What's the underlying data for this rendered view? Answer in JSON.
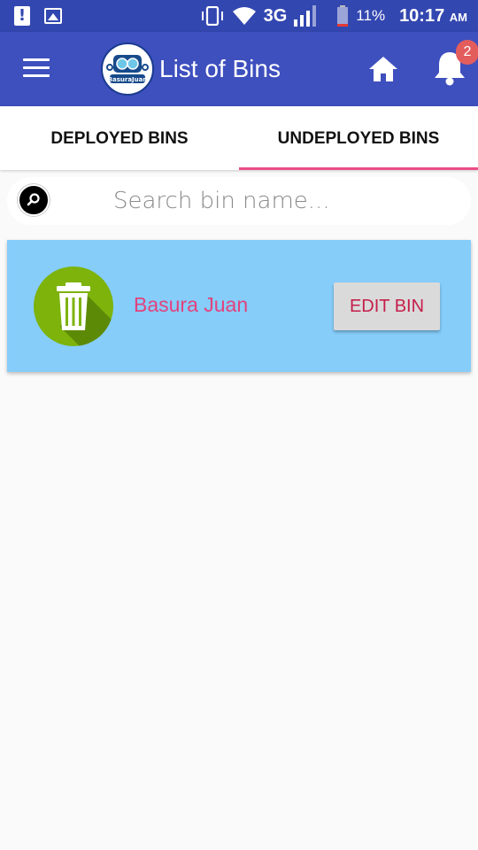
{
  "status_bar": {
    "network": "3G",
    "battery": "11%",
    "time": "10:17",
    "ampm": "AM"
  },
  "app_bar": {
    "title": "List of Bins",
    "logo_text": "BasuraJuan",
    "notification_count": "2"
  },
  "tabs": [
    {
      "label": "DEPLOYED BINS",
      "active": false
    },
    {
      "label": "UNDEPLOYED BINS",
      "active": true
    }
  ],
  "search": {
    "placeholder": "Search bin name..."
  },
  "bins": [
    {
      "name": "Basura Juan",
      "action_label": "EDIT BIN"
    }
  ],
  "colors": {
    "status_bar": "#3347b0",
    "app_bar": "#3e4fbe",
    "tab_indicator": "#ea4c89",
    "card_bg": "#86cdfa",
    "bin_name": "#e2427d",
    "edit_button_text": "#c51e4a",
    "bin_icon_bg": "#7db30a"
  },
  "icons": {
    "menu": "hamburger-icon",
    "home": "home-icon",
    "notifications": "bell-icon",
    "search": "search-icon",
    "bin": "trash-icon"
  }
}
